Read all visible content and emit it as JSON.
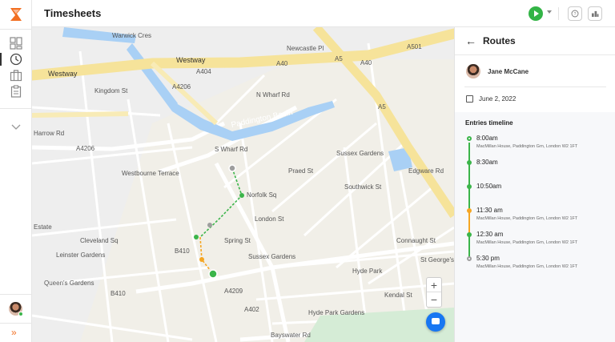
{
  "app": {
    "title": "Timesheets"
  },
  "colors": {
    "brand": "#f26f21",
    "play": "#33b446",
    "route_green": "#3bb54a",
    "break_orange": "#f5a623",
    "end_gray": "#9e9e9e",
    "chat": "#1877f2"
  },
  "sidebar": {
    "items": [
      {
        "icon": "dashboard-icon"
      },
      {
        "icon": "clock-icon"
      },
      {
        "icon": "briefcase-icon"
      },
      {
        "icon": "clipboard-icon"
      }
    ],
    "collapse_icon": "chevron-down-icon",
    "expand_glyph": "»"
  },
  "header": {
    "help_icon": "help-icon",
    "apps_icon": "apps-icon"
  },
  "map": {
    "labels": {
      "westway": "Westway",
      "a40": "A40",
      "a40b": "A40",
      "a404": "A404",
      "a4206": "A4206",
      "a4206b": "A4206",
      "a501": "A501",
      "a5": "A5",
      "a5b": "A5",
      "kingdom": "Kingdom St",
      "paddington_basin": "Paddington Basin",
      "sussex_gardens": "Sussex Gardens",
      "sussex_gardens2": "Sussex Gardens",
      "edgware": "Edgware Rd",
      "london_st": "London St",
      "spring_st": "Spring St",
      "b410": "B410",
      "b410b": "B410",
      "bayswater": "Bayswater Rd",
      "hyde_park_gardens": "Hyde Park Gardens",
      "hyde_park": "Hyde Park",
      "westbourne_terrace": "Westbourne Terrace",
      "leinster": "Leinster Gardens",
      "a402": "A402",
      "a4209": "A4209",
      "praed": "Praed St",
      "harrow": "Harrow Rd",
      "warwick": "Warwick Cres",
      "newcastle": "Newcastle Pl",
      "st_georges": "St George's Fields",
      "southwick": "Southwick St",
      "norfolk": "Norfolk Sq",
      "estate": "Estate",
      "n_wharf": "N Wharf Rd",
      "s_wharf": "S Wharf Rd",
      "queens": "Queen's Gardens",
      "cleveland": "Cleveland Sq",
      "kendal": "Kendal St",
      "connaught": "Connaught St"
    },
    "zoom_in": "+",
    "zoom_out": "−"
  },
  "panel": {
    "title": "Routes",
    "user": {
      "name": "Jane McCane"
    },
    "date": "June 2, 2022",
    "timeline_title": "Entries timeline",
    "entries": [
      {
        "time": "8:00am",
        "address": "MacMillan House, Paddington Grn, London W2 1FT",
        "status": "start"
      },
      {
        "time": "8:30am",
        "address": "",
        "status": "point"
      },
      {
        "time": "10:50am",
        "address": "",
        "status": "point"
      },
      {
        "time": "11:30 am",
        "address": "MacMillan House, Paddington Grn, London W2 1FT",
        "status": "break"
      },
      {
        "time": "12:30 am",
        "address": "MacMillan House, Paddington Grn, London W2 1FT",
        "status": "point"
      },
      {
        "time": "5:30 pm",
        "address": "MacMillan House, Paddington Grn, London W2 1FT",
        "status": "end"
      }
    ]
  }
}
